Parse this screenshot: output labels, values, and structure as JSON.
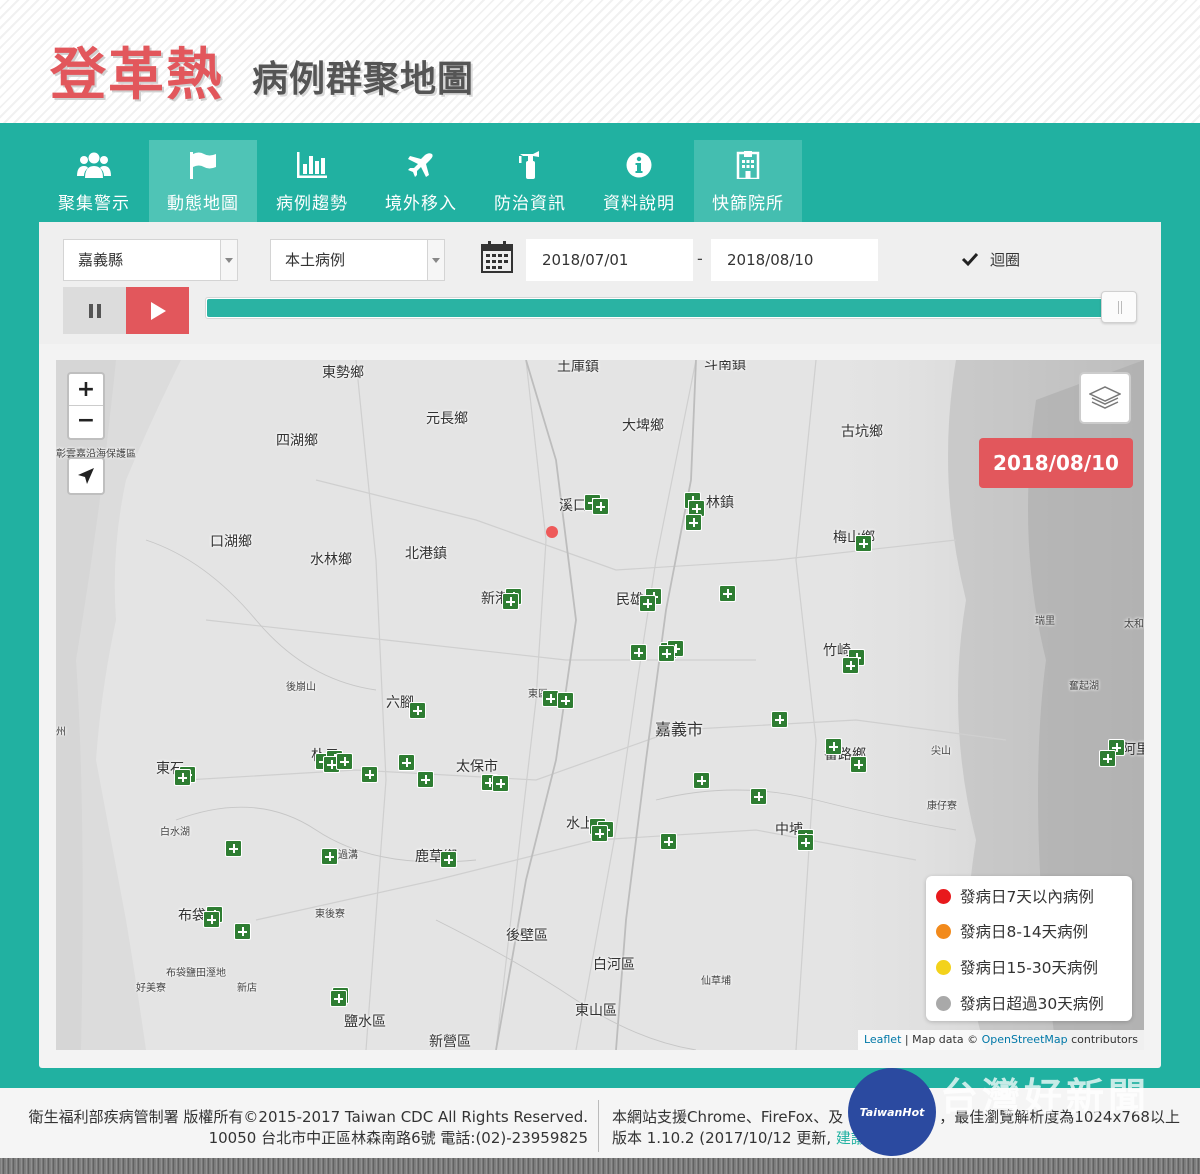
{
  "header": {
    "title_main": "登革熱",
    "title_sub": "病例群聚地圖"
  },
  "nav": {
    "tabs": [
      {
        "label": "聚集警示",
        "icon": "users-icon"
      },
      {
        "label": "動態地圖",
        "icon": "flag-icon",
        "active": true
      },
      {
        "label": "病例趨勢",
        "icon": "bar-chart-icon"
      },
      {
        "label": "境外移入",
        "icon": "airplane-icon"
      },
      {
        "label": "防治資訊",
        "icon": "fire-extinguisher-icon"
      },
      {
        "label": "資料說明",
        "icon": "info-icon"
      },
      {
        "label": "快篩院所",
        "icon": "hospital-icon"
      }
    ]
  },
  "controls": {
    "county_select": "嘉義縣",
    "case_type_select": "本土病例",
    "start_date": "2018/07/01",
    "date_separator": "-",
    "end_date": "2018/08/10",
    "loop_label": "迴圈",
    "loop_checked": true,
    "timeline_progress": 0.99
  },
  "map": {
    "current_date": "2018/08/10",
    "zoom_in_label": "+",
    "zoom_out_label": "−",
    "labels": [
      "東勢鄉",
      "土庫鎮",
      "斗南鎮",
      "元長鄉",
      "四湖鄉",
      "大埤鄉",
      "古坑鄉",
      "彰雲嘉沿海保護區",
      "溪口",
      "林鎮",
      "口湖鄉",
      "水林鄉",
      "北港鎮",
      "梅山鄉",
      "新港",
      "民雄",
      "瑞里",
      "太和",
      "竹崎",
      "後崩山",
      "奮起湖",
      "六腳",
      "東區",
      "嘉義市",
      "尖山",
      "番路鄉",
      "阿里",
      "東石",
      "朴子",
      "太保市",
      "康仔寮",
      "中埔",
      "白水湖",
      "水上",
      "鹿草鄉",
      "布袋",
      "東後寮",
      "後壁區",
      "白河區",
      "仙草埔",
      "布袋鹽田溼地",
      "好美寮",
      "新店",
      "東山區",
      "鹽水區",
      "新營區",
      "州",
      "過溝"
    ],
    "legend": [
      {
        "label": "發病日7天以內病例",
        "color": "#e8191c"
      },
      {
        "label": "發病日8-14天病例",
        "color": "#f28a1c"
      },
      {
        "label": "發病日15-30天病例",
        "color": "#f3d21b"
      },
      {
        "label": "發病日超過30天病例",
        "color": "#a9a9a9"
      }
    ],
    "attribution": {
      "leaflet": "Leaflet",
      "separator": " | Map data © ",
      "osm": "OpenStreetMap",
      "suffix": " contributors"
    }
  },
  "footer": {
    "line1": "衛生福利部疾病管制署 版權所有©2015-2017 Taiwan CDC All Rights Reserved.",
    "line2": "10050 台北市中正區林森南路6號 電話:(02)-23959825",
    "line3_prefix": "本網站支援Chrome、FireFox、及",
    "line3_suffix": "，最佳瀏覽解析度為1024x768以上",
    "line4_prefix": "版本 1.10.2 (2017/10/12 更新,",
    "line4_link": "建議",
    "watermark": "台灣好新聞",
    "watermark_logo": "TaiwanHot"
  }
}
